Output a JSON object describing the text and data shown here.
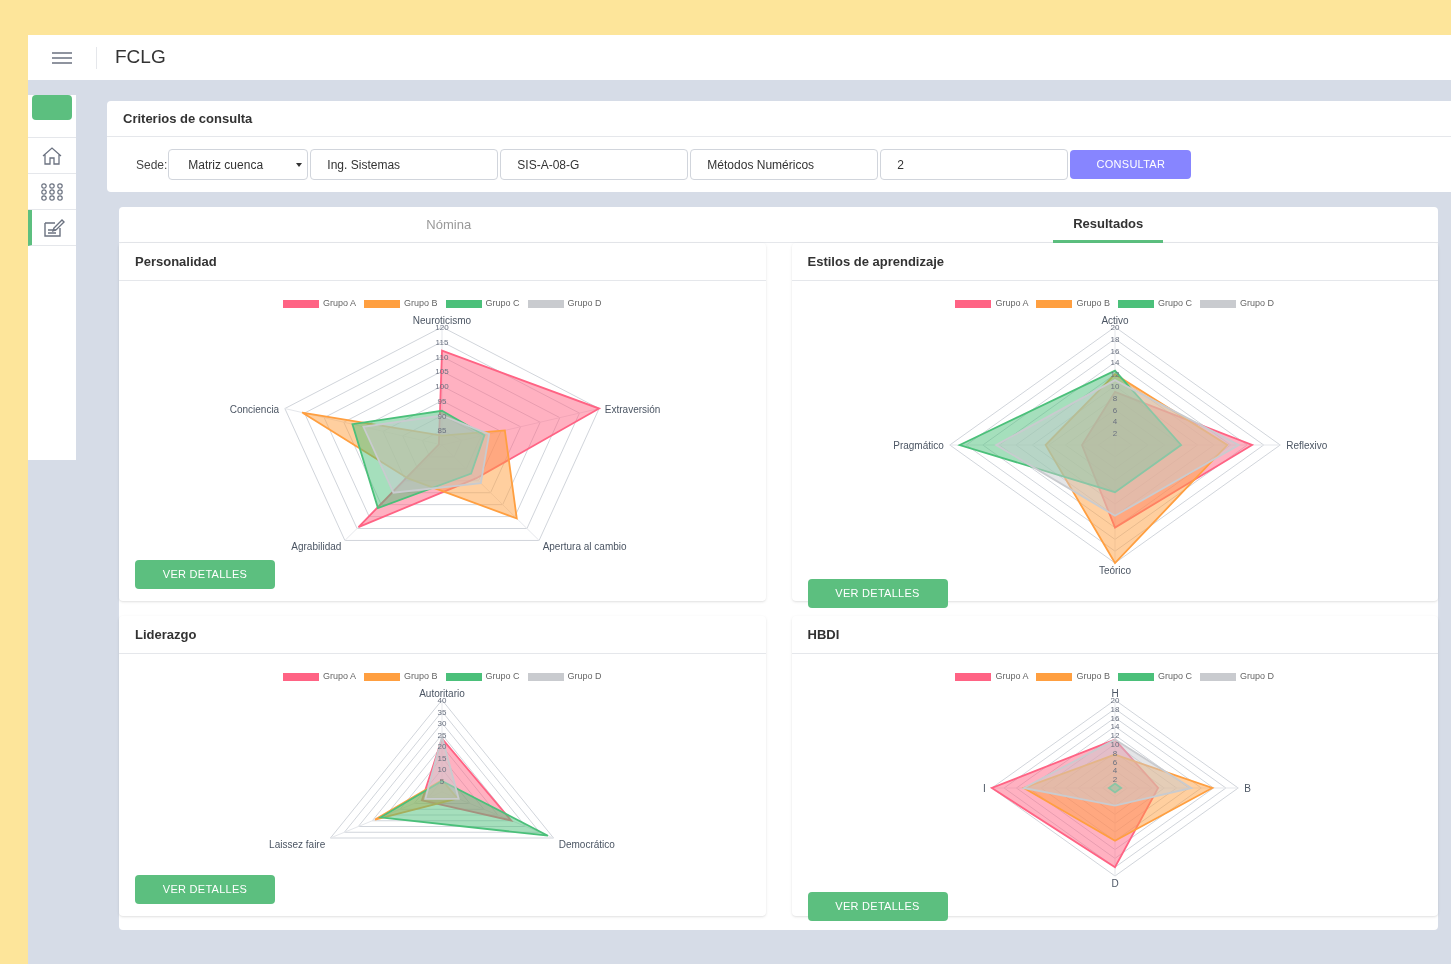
{
  "header": {
    "title": "FCLG"
  },
  "sidebar": {
    "items": [
      {
        "kind": "home",
        "selected": false
      },
      {
        "kind": "grid",
        "selected": false
      },
      {
        "kind": "edit",
        "selected": true
      }
    ]
  },
  "criteria": {
    "title": "Criterios de consulta",
    "sede_label": "Sede:",
    "fields": [
      {
        "kind": "select",
        "value": "Matriz cuenca"
      },
      {
        "kind": "text",
        "value": "Ing. Sistemas"
      },
      {
        "kind": "text",
        "value": "SIS-A-08-G"
      },
      {
        "kind": "text",
        "value": "Métodos Numéricos"
      },
      {
        "kind": "text",
        "value": "2"
      }
    ],
    "button": "CONSULTAR"
  },
  "tabs": [
    {
      "label": "Nómina",
      "selected": false
    },
    {
      "label": "Resultados",
      "selected": true
    }
  ],
  "cards": [
    {
      "title": "Personalidad",
      "button": "VER DETALLES",
      "axes": [
        "Neuroticismo",
        "Conciencia",
        "Extraversión",
        "Agrabilidad",
        "Apertura al cambio"
      ],
      "ticks": [
        "120",
        "115",
        "110",
        "105",
        "100",
        "95",
        "90",
        "85"
      ],
      "legend": [
        {
          "name": "Grupo A",
          "color": "#ff6384"
        },
        {
          "name": "Grupo B",
          "color": "#ff9f40"
        },
        {
          "name": "Grupo C",
          "color": "#4bc07a"
        },
        {
          "name": "Grupo D",
          "color": "#c9cbcf"
        }
      ]
    },
    {
      "title": "Estilos de aprendizaje",
      "button": "VER DETALLES",
      "axes": [
        "Activo",
        "Pragmático",
        "Reflexivo",
        "Teórico"
      ],
      "ticks": [
        "20",
        "18",
        "16",
        "14",
        "12",
        "10",
        "8",
        "6",
        "4",
        "2"
      ],
      "legend": [
        {
          "name": "Grupo A",
          "color": "#ff6384"
        },
        {
          "name": "Grupo B",
          "color": "#ff9f40"
        },
        {
          "name": "Grupo C",
          "color": "#4bc07a"
        },
        {
          "name": "Grupo D",
          "color": "#c9cbcf"
        }
      ]
    },
    {
      "title": "Liderazgo",
      "button": "VER DETALLES",
      "axes": [
        "Autoritario",
        "Laissez faire",
        "Democrático"
      ],
      "ticks": [
        "40",
        "35",
        "30",
        "25",
        "20",
        "15",
        "10",
        "5"
      ],
      "legend": [
        {
          "name": "Grupo A",
          "color": "#ff6384"
        },
        {
          "name": "Grupo B",
          "color": "#ff9f40"
        },
        {
          "name": "Grupo C",
          "color": "#4bc07a"
        },
        {
          "name": "Grupo D",
          "color": "#c9cbcf"
        }
      ]
    },
    {
      "title": "HBDI",
      "button": "VER DETALLES",
      "axes": [
        "H",
        "I",
        "B",
        "D"
      ],
      "ticks": [
        "20",
        "18",
        "16",
        "14",
        "12",
        "10",
        "8",
        "6",
        "4",
        "2"
      ],
      "legend": [
        {
          "name": "Grupo A",
          "color": "#ff6384"
        },
        {
          "name": "Grupo B",
          "color": "#ff9f40"
        },
        {
          "name": "Grupo C",
          "color": "#4bc07a"
        },
        {
          "name": "Grupo D",
          "color": "#c9cbcf"
        }
      ]
    }
  ]
}
